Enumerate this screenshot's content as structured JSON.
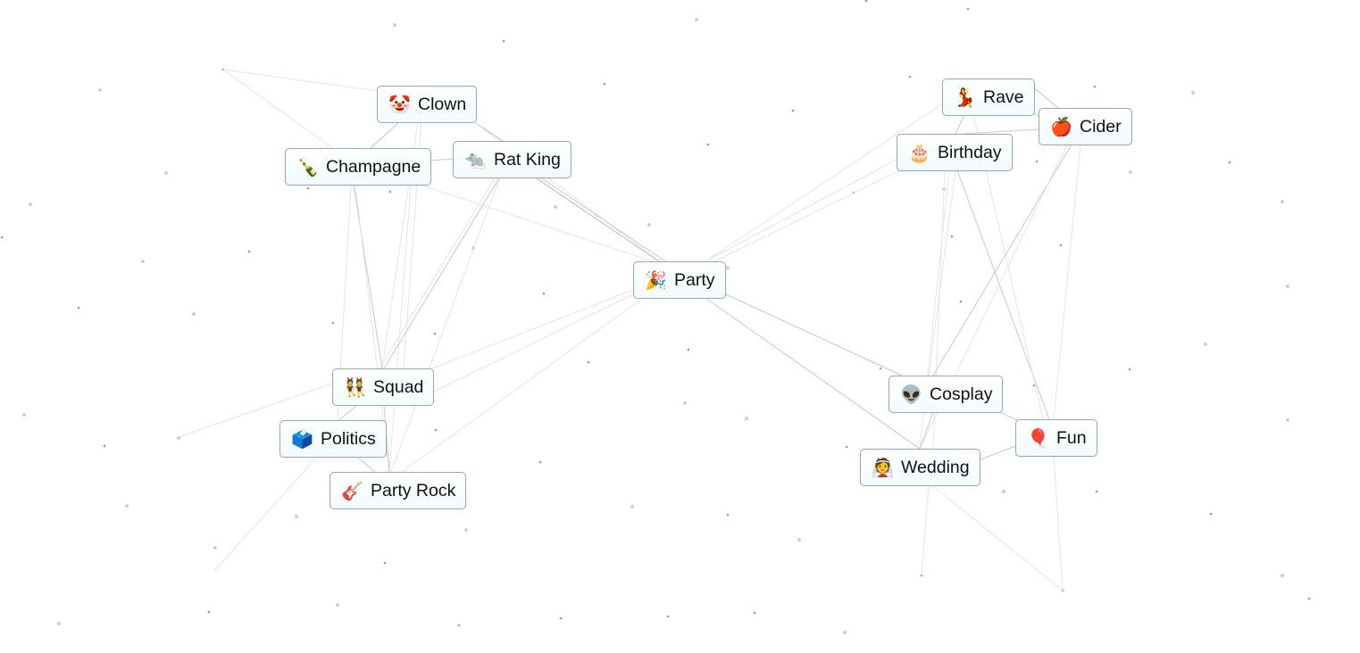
{
  "app": {
    "description": "Infinite Craft style element board"
  },
  "elements": [
    {
      "id": "clown",
      "label": "Clown",
      "emoji": "🤡",
      "icon": "clown-face-icon"
    },
    {
      "id": "champagne",
      "label": "Champagne",
      "emoji": "🍾",
      "icon": "champagne-bottle-icon"
    },
    {
      "id": "rat-king",
      "label": "Rat King",
      "emoji": "🐀",
      "icon": "rat-icon"
    },
    {
      "id": "party",
      "label": "Party",
      "emoji": "🎉",
      "icon": "party-popper-icon"
    },
    {
      "id": "squad",
      "label": "Squad",
      "emoji": "👯",
      "icon": "people-with-bunny-ears-icon"
    },
    {
      "id": "politics",
      "label": "Politics",
      "emoji": "🗳️",
      "icon": "ballot-box-icon"
    },
    {
      "id": "party-rock",
      "label": "Party Rock",
      "emoji": "🎸",
      "icon": "guitar-icon"
    },
    {
      "id": "rave",
      "label": "Rave",
      "emoji": "💃",
      "icon": "dancer-icon"
    },
    {
      "id": "cider",
      "label": "Cider",
      "emoji": "🍎",
      "icon": "red-apple-icon"
    },
    {
      "id": "birthday",
      "label": "Birthday",
      "emoji": "🎂",
      "icon": "birthday-cake-icon"
    },
    {
      "id": "cosplay",
      "label": "Cosplay",
      "emoji": "👽",
      "icon": "alien-icon"
    },
    {
      "id": "fun",
      "label": "Fun",
      "emoji": "🎈",
      "icon": "balloon-icon"
    },
    {
      "id": "wedding",
      "label": "Wedding",
      "emoji": "👰",
      "icon": "bride-icon"
    }
  ]
}
